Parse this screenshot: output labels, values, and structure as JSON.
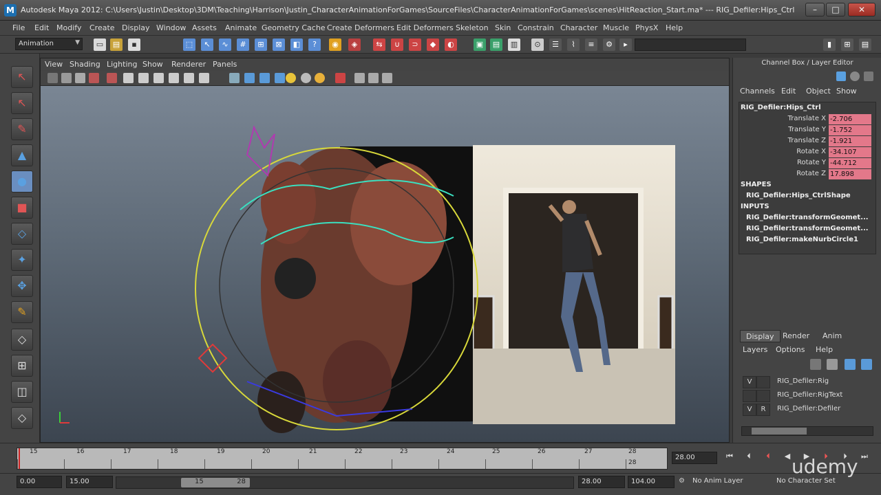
{
  "window": {
    "title": "Autodesk Maya 2012: C:\\Users\\Justin\\Desktop\\3DM\\Teaching\\Harrison\\Justin_CharacterAnimationForGames\\SourceFiles\\CharacterAnimationForGames\\scenes\\HitReaction_Start.ma*   ---   RIG_Defiler:Hips_Ctrl",
    "logo": "M"
  },
  "menu": [
    "File",
    "Edit",
    "Modify",
    "Create",
    "Display",
    "Window",
    "Assets",
    "Animate",
    "Geometry Cache",
    "Create Deformers",
    "Edit Deformers",
    "Skeleton",
    "Skin",
    "Constrain",
    "Character",
    "Muscle",
    "PhysX",
    "Help"
  ],
  "statusline": {
    "mode": "Animation"
  },
  "viewport": {
    "menu": [
      "View",
      "Shading",
      "Lighting",
      "Show",
      "Renderer",
      "Panels"
    ],
    "axis_label": "Y\nX"
  },
  "channelbox": {
    "title": "Channel Box / Layer Editor",
    "menu": [
      "Channels",
      "Edit",
      "Object",
      "Show"
    ],
    "object": "RIG_Defiler:Hips_Ctrl",
    "attrs": [
      {
        "name": "Translate X",
        "value": "-2.706"
      },
      {
        "name": "Translate Y",
        "value": "-1.752"
      },
      {
        "name": "Translate Z",
        "value": "-1.921"
      },
      {
        "name": "Rotate X",
        "value": "-34.107"
      },
      {
        "name": "Rotate Y",
        "value": "-44.712"
      },
      {
        "name": "Rotate Z",
        "value": "17.898"
      }
    ],
    "shapes_label": "SHAPES",
    "shape": "RIG_Defiler:Hips_CtrlShape",
    "inputs_label": "INPUTS",
    "inputs": [
      "RIG_Defiler:transformGeomet...",
      "RIG_Defiler:transformGeomet...",
      "RIG_Defiler:makeNurbCircle1"
    ]
  },
  "layers": {
    "tabs": [
      "Display",
      "Render",
      "Anim"
    ],
    "menu": [
      "Layers",
      "Options",
      "Help"
    ],
    "rows": [
      {
        "v": "V",
        "r": "",
        "name": "RIG_Defiler:Rig"
      },
      {
        "v": "",
        "r": "",
        "name": "RIG_Defiler:RigText"
      },
      {
        "v": "V",
        "r": "R",
        "name": "RIG_Defiler:Defiler"
      }
    ]
  },
  "timeline": {
    "ticks": [
      "15",
      "16",
      "17",
      "18",
      "19",
      "20",
      "21",
      "22",
      "23",
      "24",
      "25",
      "26",
      "27",
      "28"
    ],
    "current_frame": "28.00",
    "end_marker": "28"
  },
  "range": {
    "start": "0.00",
    "playback_start": "15.00",
    "thumb_start": "15",
    "thumb_end": "28",
    "playback_end": "28.00",
    "end": "104.00",
    "anim_layer": "No Anim Layer",
    "character_set": "No Character Set"
  },
  "watermark": "udemy"
}
